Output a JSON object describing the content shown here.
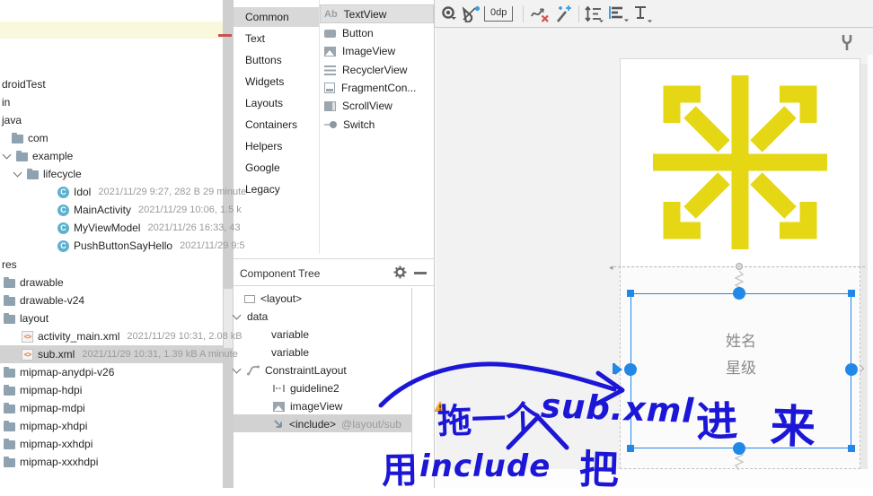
{
  "colors": {
    "selection_blue": "#2288e8",
    "snowflake_yellow": "#e5d713",
    "annotation_blue": "#1c16d6",
    "warning_orange": "#f2a33a",
    "highlight_red": "#c75450"
  },
  "project": {
    "rows": [
      {
        "label": "droidTest"
      },
      {
        "label": "in"
      },
      {
        "label": "java"
      },
      {
        "label": "com"
      },
      {
        "label": "example"
      },
      {
        "label": "lifecycle"
      },
      {
        "label": "Idol",
        "meta": "2021/11/29 9:27, 282 B 29 minute"
      },
      {
        "label": "MainActivity",
        "meta": "2021/11/29 10:06, 1.5 k"
      },
      {
        "label": "MyViewModel",
        "meta": "2021/11/26 16:33, 43"
      },
      {
        "label": "PushButtonSayHello",
        "meta": "2021/11/29 9:5"
      },
      {
        "label": "res"
      },
      {
        "label": "drawable"
      },
      {
        "label": "drawable-v24"
      },
      {
        "label": "layout"
      },
      {
        "label": "activity_main.xml",
        "meta": "2021/11/29 10:31, 2.08 kB"
      },
      {
        "label": "sub.xml",
        "meta": "2021/11/29 10:31, 1.39 kB A minute"
      },
      {
        "label": "mipmap-anydpi-v26"
      },
      {
        "label": "mipmap-hdpi"
      },
      {
        "label": "mipmap-mdpi"
      },
      {
        "label": "mipmap-xhdpi"
      },
      {
        "label": "mipmap-xxhdpi"
      },
      {
        "label": "mipmap-xxxhdpi"
      }
    ]
  },
  "palette": {
    "categories": [
      {
        "label": "Common",
        "selected": true
      },
      {
        "label": "Text"
      },
      {
        "label": "Buttons"
      },
      {
        "label": "Widgets"
      },
      {
        "label": "Layouts"
      },
      {
        "label": "Containers"
      },
      {
        "label": "Helpers"
      },
      {
        "label": "Google"
      },
      {
        "label": "Legacy"
      }
    ],
    "components": [
      {
        "label": "TextView",
        "selected": true
      },
      {
        "label": "Button"
      },
      {
        "label": "ImageView"
      },
      {
        "label": "RecyclerView"
      },
      {
        "label": "FragmentCon..."
      },
      {
        "label": "ScrollView"
      },
      {
        "label": "Switch"
      }
    ]
  },
  "component_tree": {
    "title": "Component Tree",
    "nodes": [
      {
        "label": "<layout>"
      },
      {
        "label": "data"
      },
      {
        "label": "variable"
      },
      {
        "label": "variable"
      },
      {
        "label": "ConstraintLayout"
      },
      {
        "label": "guideline2"
      },
      {
        "label": "imageView"
      },
      {
        "label": "<include>",
        "suffix": "@layout/sub",
        "selected": true
      }
    ]
  },
  "toolbar": {
    "margin_value": "0dp"
  },
  "design": {
    "include_preview": {
      "line1": "姓名",
      "line2": "星级"
    }
  },
  "annotation": {
    "line1_zh_prefix": "拖一个",
    "line1_latin": "sub.xml",
    "line1_zh_jin": "进",
    "line1_zh_lai": "来",
    "line2_zh_prefix": "用",
    "line2_latin": "include",
    "line2_zh_suffix": "把"
  }
}
